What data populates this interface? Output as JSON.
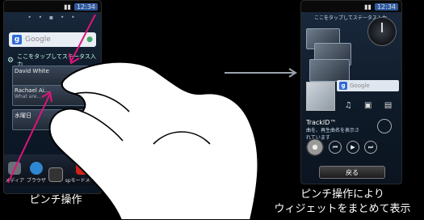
{
  "left_phone": {
    "status_time": "12:34",
    "search_placeholder": "Google",
    "search_badge": "g",
    "tap_hint": "ここをタップしてステータス入力",
    "cards": [
      {
        "name": "David White",
        "sub": ""
      },
      {
        "name": "Rachael Ai...",
        "sub": "What are..."
      },
      {
        "name": "水曜日",
        "sub": ""
      }
    ],
    "dock": [
      "メディア",
      "ブラウザ",
      "",
      "spモードメール"
    ]
  },
  "right_phone": {
    "status_time": "12:34",
    "top_hint": "ここをタップしてステータス入力",
    "search_placeholder": "Google",
    "search_badge": "g",
    "trackid_title": "TrackID™",
    "trackid_sub": "曲を、再生曲名を表示されています",
    "back_label": "戻る"
  },
  "captions": {
    "left": "ピンチ操作",
    "right_line1": "ピンチ操作により",
    "right_line2": "ウィジェットをまとめて表示"
  },
  "colors": {
    "background": "#000000",
    "arrow_pink": "#e0147a",
    "flow_arrow": "#9aa3ad"
  }
}
